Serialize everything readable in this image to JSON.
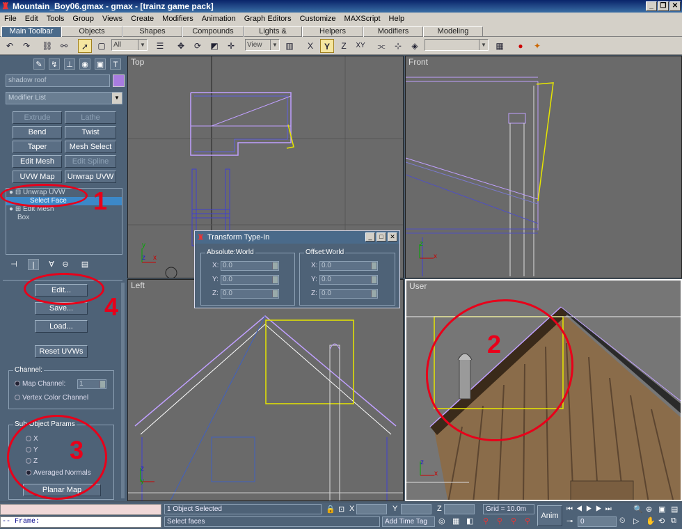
{
  "window": {
    "title": "Mountain_Boy06.gmax - gmax - [trainz game pack]",
    "buttons": [
      "_",
      "❐",
      "✕"
    ]
  },
  "menu": [
    "File",
    "Edit",
    "Tools",
    "Group",
    "Views",
    "Create",
    "Modifiers",
    "Animation",
    "Graph Editors",
    "Customize",
    "MAXScript",
    "Help"
  ],
  "tabs": [
    "Main Toolbar",
    "Objects",
    "Shapes",
    "Compounds",
    "Lights & Cameras",
    "Helpers",
    "Modifiers",
    "Modeling"
  ],
  "toolbar": {
    "filter_value": "All",
    "coord_value": "View"
  },
  "command_panel": {
    "object_name": "shadow roof",
    "modifier_list": "Modifier List",
    "modifier_buttons": [
      "Extrude",
      "Lathe",
      "Bend",
      "Twist",
      "Taper",
      "Mesh Select",
      "Edit Mesh",
      "Edit Spline",
      "UVW Map",
      "Unwrap UVW"
    ],
    "stack": [
      "Unwrap UVW",
      "Select Face",
      "Edit Mesh",
      "Box"
    ],
    "edit_btn": "Edit...",
    "save_btn": "Save...",
    "load_btn": "Load...",
    "reset_btn": "Reset UVWs",
    "channel_legend": "Channel:",
    "map_channel_label": "Map Channel:",
    "map_channel_value": "1",
    "vertex_color_label": "Vertex Color Channel",
    "subobj_legend": "Sub Object Params",
    "axis_options": [
      "X",
      "Y",
      "Z",
      "Averaged Normals"
    ],
    "planar_map_btn": "Planar Map"
  },
  "viewports": {
    "top": "Top",
    "front": "Front",
    "left": "Left",
    "user": "User"
  },
  "dialog": {
    "title": "Transform Type-In",
    "absolute_legend": "Absolute:World",
    "offset_legend": "Offset:World",
    "axes": [
      "X:",
      "Y:",
      "Z:"
    ],
    "values": [
      "0.0",
      "0.0",
      "0.0"
    ],
    "offset_values": [
      "0.0",
      "0.0",
      "0.0"
    ]
  },
  "status": {
    "prompt_line": "-- Frame:",
    "selection": "1 Object Selected",
    "hint": "Select faces",
    "x_label": "X",
    "y_label": "Y",
    "z_label": "Z",
    "grid": "Grid = 10.0m",
    "add_time_tag": "Add Time Tag",
    "anim": "Anim",
    "frame_value": "0"
  },
  "annotations": [
    "1",
    "2",
    "3",
    "4"
  ]
}
